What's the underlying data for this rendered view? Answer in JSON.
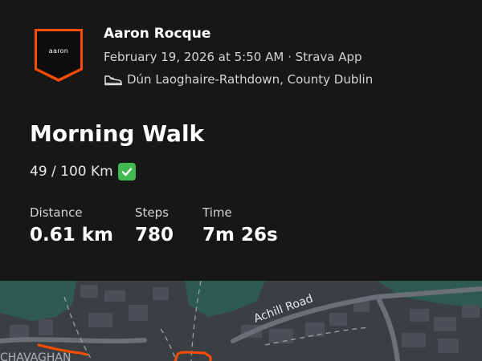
{
  "athlete": {
    "name": "Aaron Rocque",
    "avatar_text": "aaron",
    "datetime": "February 19, 2026 at 5:50 AM",
    "separator": "·",
    "source": "Strava App",
    "location": "Dún Laoghaire-Rathdown, County Dublin"
  },
  "activity": {
    "title": "Morning Walk",
    "description": "49 / 100 Km"
  },
  "stats": [
    {
      "label": "Distance",
      "value": "0.61 km"
    },
    {
      "label": "Steps",
      "value": "780"
    },
    {
      "label": "Time",
      "value": "7m 26s"
    }
  ],
  "map": {
    "road_label": "Achill Road",
    "partial_label": "CHAVAGHAN"
  },
  "colors": {
    "accent": "#fc4c02",
    "background": "#171717",
    "map_bg": "#3a3f44",
    "park": "#2f5a50",
    "check": "#3fb950"
  },
  "icons": {
    "location": "shoe-icon",
    "description_badge": "check-mark-icon"
  }
}
